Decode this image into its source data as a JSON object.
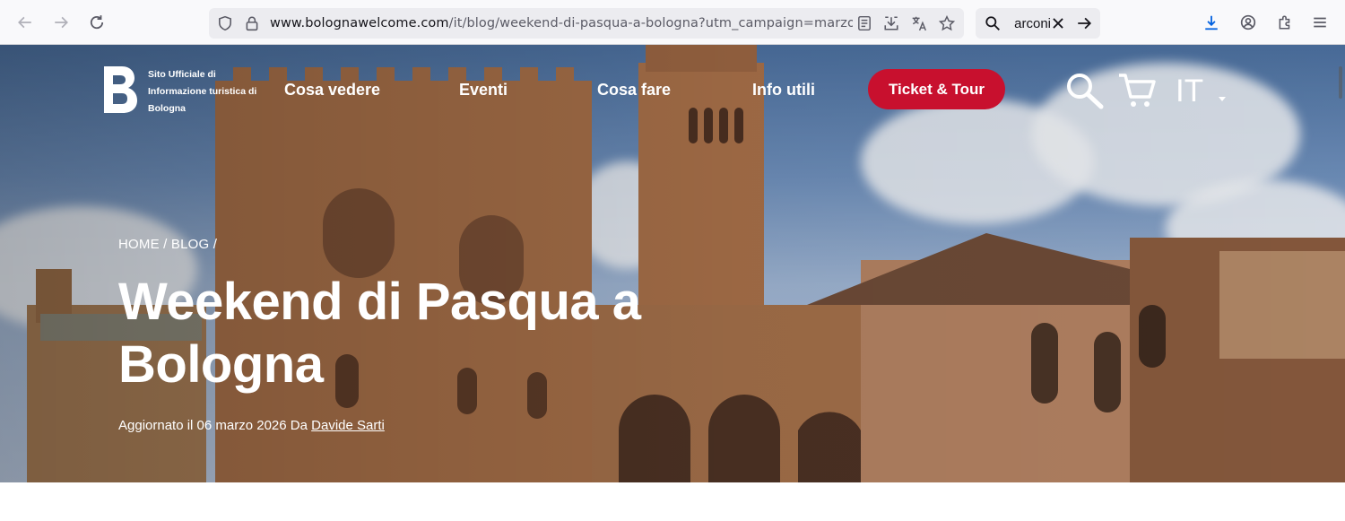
{
  "browser": {
    "url_domain": "www.bolognawelcome.com",
    "url_path": "/it/blog/weekend-di-pasqua-a-bologna?utm_campaign=marzo_marketing",
    "search_value": "arconi"
  },
  "site": {
    "logo_text": "Sito Ufficiale di Informazione turistica di Bologna",
    "nav": [
      "Cosa vedere",
      "Eventi",
      "Cosa fare",
      "Info utili"
    ],
    "cta": "Ticket & Tour",
    "language": "IT"
  },
  "article": {
    "breadcrumb": "HOME / BLOG /",
    "title": "Weekend di Pasqua a Bologna",
    "updated_prefix": "Aggiornato il 06 marzo 2026 Da",
    "author": "Davide Sarti"
  },
  "colors": {
    "accent": "#c8102e",
    "toolbar": "#f9f9fb"
  }
}
